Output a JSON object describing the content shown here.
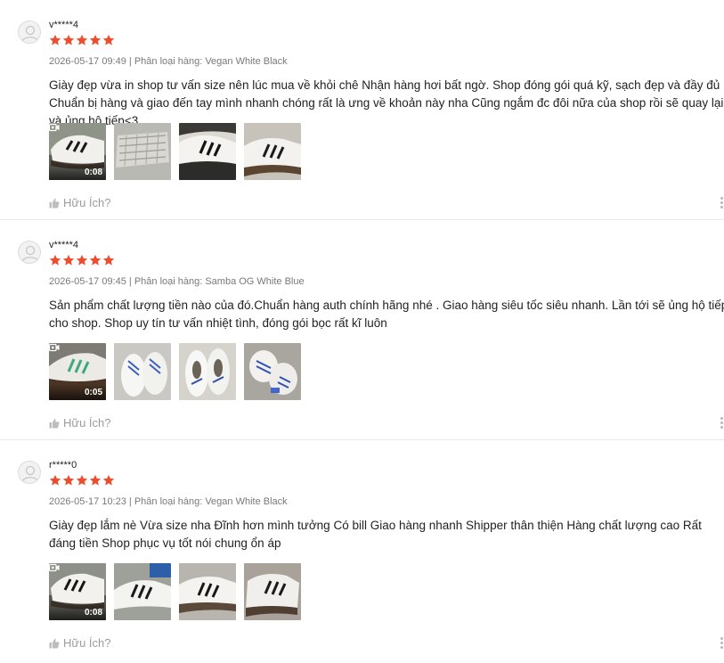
{
  "colors": {
    "star": "#ee4d2d",
    "meta": "#757575",
    "helpful": "#9e9e9e"
  },
  "icons": {
    "avatar": "default-user-avatar-icon",
    "star": "star-icon",
    "video": "video-camera-icon",
    "helpful": "thumb-up-icon",
    "more": "more-vertical-icon"
  },
  "reviews": [
    {
      "username": "v*****4",
      "rating": 5,
      "meta": "2026-05-17 09:49 | Phân loại hàng: Vegan White Black",
      "content": "Giày đẹp vừa in shop tư vấn size nên lúc mua về khỏi chê Nhận hàng hơi bất ngờ. Shop đóng gói quá kỹ, sạch đẹp và đầy đủ Chuẩn bị hàng và giao đến tay mình nhanh chóng rất là ưng về khoản này nha Cũng ngắm đc đôi nữa của shop rồi sẽ quay lại và ủng hộ tiếp<3",
      "video_duration": "0:08",
      "helpful_label": "Hữu Ích?"
    },
    {
      "username": "v*****4",
      "rating": 5,
      "meta": "2026-05-17 09:45 | Phân loại hàng: Samba OG White Blue",
      "content": "Sản phẩm chất lượng tiền nào của đó.Chuẩn hàng auth chính hãng nhé . Giao hàng siêu tốc siêu nhanh. Lần tới sẽ ủng hộ tiếp cho shop. Shop uy tín tư vấn nhiệt tình, đóng gói bọc rất kĩ luôn",
      "video_duration": "0:05",
      "helpful_label": "Hữu Ích?"
    },
    {
      "username": "r*****0",
      "rating": 5,
      "meta": "2026-05-17 10:23 | Phân loại hàng: Vegan White Black",
      "content": "Giày đẹp lắm nè Vừa size nha Đĩnh hơn mình tưởng Có bill Giao hàng nhanh Shipper thân thiện Hàng chất lượng cao Rất đáng tiền Shop phục vụ tốt nói chung ổn áp",
      "video_duration": "0:08",
      "helpful_label": "Hữu Ích?"
    }
  ]
}
